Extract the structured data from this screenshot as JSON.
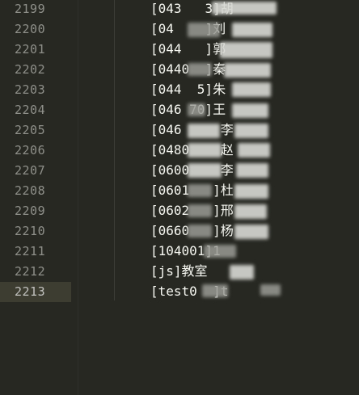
{
  "editor": {
    "current_line": "2213",
    "lines": [
      {
        "no": "2199",
        "text": "[043"
      },
      {
        "no": "2200",
        "text": "[04"
      },
      {
        "no": "2201",
        "text": "[044"
      },
      {
        "no": "2202",
        "text": "[0440"
      },
      {
        "no": "2203",
        "text": "[044"
      },
      {
        "no": "2204",
        "text": "[046"
      },
      {
        "no": "2205",
        "text": "[046"
      },
      {
        "no": "2206",
        "text": "[0480"
      },
      {
        "no": "2207",
        "text": "[0600"
      },
      {
        "no": "2208",
        "text": "[0601"
      },
      {
        "no": "2209",
        "text": "[0602"
      },
      {
        "no": "2210",
        "text": "[0660"
      },
      {
        "no": "2211",
        "text": "[104001]1"
      },
      {
        "no": "2212",
        "text": "[js]教室"
      },
      {
        "no": "2213",
        "text": "[test0"
      }
    ],
    "visible_fragments": {
      "r2199": "胡",
      "r2200": "刘",
      "r2201": "郭",
      "r2202": "秦",
      "r2203": "朱",
      "r2204": "王",
      "r2205": "李",
      "r2206": "赵",
      "r2207": "李",
      "r2208": "杜",
      "r2209": "邢",
      "r2210": "杨",
      "r2213": "]t"
    }
  }
}
